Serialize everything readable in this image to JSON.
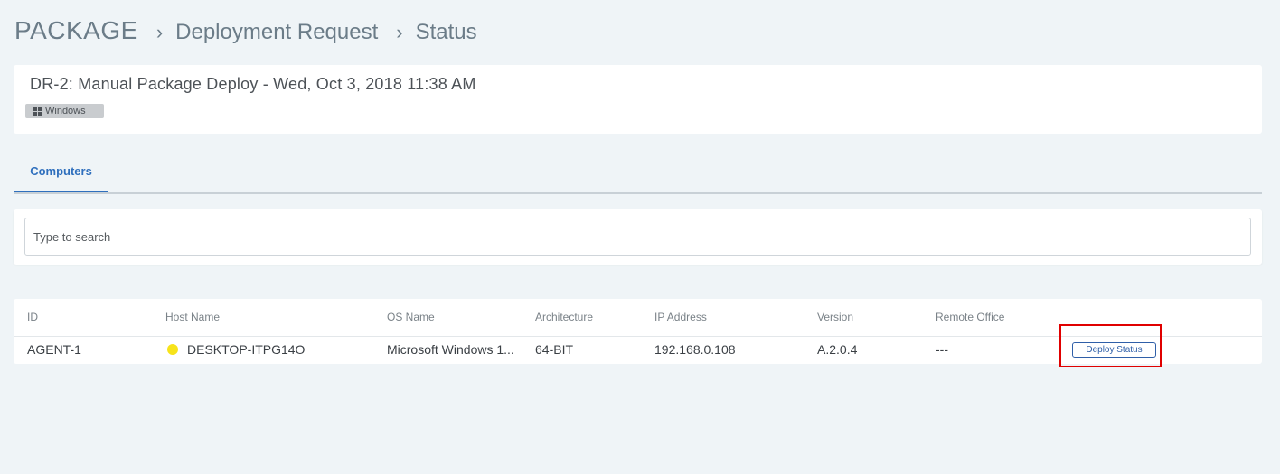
{
  "breadcrumb": {
    "root": "PACKAGE",
    "items": [
      "Deployment Request",
      "Status"
    ]
  },
  "request": {
    "title": "DR-2: Manual Package Deploy - Wed, Oct 3, 2018 11:38 AM",
    "os_badge": "Windows",
    "os_icon": "windows-icon"
  },
  "tabs": [
    {
      "label": "Computers",
      "active": true
    }
  ],
  "search": {
    "placeholder": "Type to search",
    "value": ""
  },
  "table": {
    "headers": [
      "ID",
      "Host Name",
      "OS Name",
      "Architecture",
      "IP Address",
      "Version",
      "Remote Office"
    ],
    "rows": [
      {
        "id": "AGENT-1",
        "host_name": "DESKTOP-ITPG14O",
        "status_color": "#f7e31a",
        "os_name": "Microsoft Windows 1...",
        "architecture": "64-BIT",
        "ip_address": "192.168.0.108",
        "version": "A.2.0.4",
        "remote_office": "---",
        "action_label": "Deploy Status"
      }
    ]
  },
  "colors": {
    "accent": "#2f6fbd",
    "highlight": "#e00000",
    "background": "#eff4f7"
  }
}
